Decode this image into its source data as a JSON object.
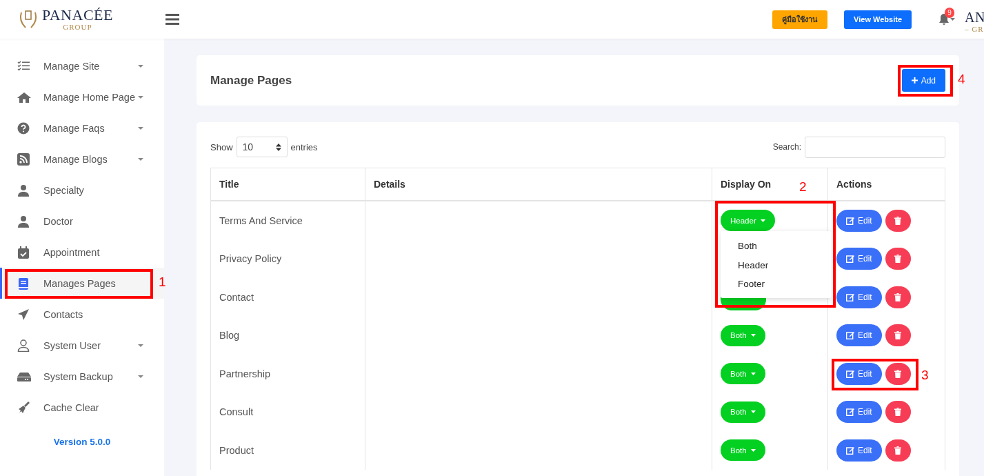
{
  "header": {
    "logo": {
      "name": "PANACÉE",
      "sub": "GROUP"
    },
    "manual_button": "คู่มือใช้งาน",
    "view_button": "View Website",
    "notifications": "9",
    "profile_logo": {
      "name": "AN",
      "sub": "– GR"
    }
  },
  "sidebar": {
    "items": [
      {
        "label": "Manage Site",
        "expandable": true,
        "selected": false
      },
      {
        "label": "Manage Home Page",
        "expandable": true,
        "selected": false
      },
      {
        "label": "Manage Faqs",
        "expandable": true,
        "selected": false
      },
      {
        "label": "Manage Blogs",
        "expandable": true,
        "selected": false
      },
      {
        "label": "Specialty",
        "expandable": false,
        "selected": false
      },
      {
        "label": "Doctor",
        "expandable": false,
        "selected": false
      },
      {
        "label": "Appointment",
        "expandable": false,
        "selected": false
      },
      {
        "label": "Manages Pages",
        "expandable": false,
        "selected": true
      },
      {
        "label": "Contacts",
        "expandable": false,
        "selected": false
      },
      {
        "label": "System User",
        "expandable": true,
        "selected": false
      },
      {
        "label": "System Backup",
        "expandable": true,
        "selected": false
      },
      {
        "label": "Cache Clear",
        "expandable": false,
        "selected": false
      }
    ],
    "version": "Version 5.0.0"
  },
  "page_header": {
    "title": "Manage Pages",
    "add_button": "Add"
  },
  "table_controls": {
    "show_label": "Show",
    "page_size": "10",
    "entries_label": "entries",
    "search_label": "Search:"
  },
  "table": {
    "columns": [
      "Title",
      "Details",
      "Display On",
      "Actions"
    ],
    "rows": [
      {
        "title": "Terms And Service",
        "display": "Header",
        "edit": "Edit"
      },
      {
        "title": "Privacy Policy",
        "edit": "Edit"
      },
      {
        "title": "Contact",
        "display_partly_covered": true,
        "edit": "Edit"
      },
      {
        "title": "Blog",
        "display": "Both",
        "edit": "Edit"
      },
      {
        "title": "Partnership",
        "display": "Both",
        "edit": "Edit"
      },
      {
        "title": "Consult",
        "display": "Both",
        "edit": "Edit"
      },
      {
        "title": "Product",
        "display": "Both",
        "edit": "Edit"
      }
    ],
    "dropdown_menu": {
      "options": [
        "Both",
        "Header",
        "Footer"
      ]
    }
  },
  "annotations": [
    {
      "label": "1"
    },
    {
      "label": "2"
    },
    {
      "label": "3"
    },
    {
      "label": "4"
    }
  ]
}
